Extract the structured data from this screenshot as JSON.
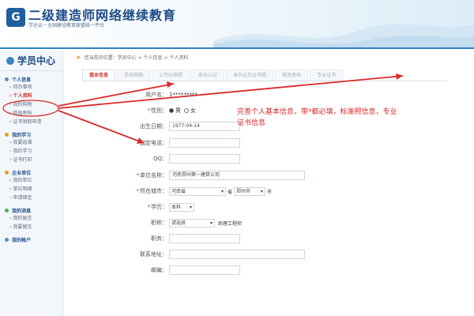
{
  "header": {
    "logo_char": "G",
    "brand": "二级建造师网络继续教育",
    "subtitle": "学达云－全国建设教育联盟统一平台"
  },
  "sidebar": {
    "title": "学员中心",
    "sections": [
      {
        "title": "个人信息",
        "items": [
          "待办事项",
          "个人资料",
          "我的购物",
          "修改密码",
          "证书领取申请"
        ]
      },
      {
        "title": "我的学习",
        "items": [
          "我要选课",
          "我的学习",
          "证书打印"
        ]
      },
      {
        "title": "企业单位",
        "items": [
          "我的单位",
          "单位明细",
          "申请绑定"
        ]
      },
      {
        "title": "我的消息",
        "items": [
          "我的留言",
          "我要留言"
        ]
      },
      {
        "title": "我的帐户",
        "items": []
      }
    ]
  },
  "breadcrumb": "您当前的位置：学员中心 > 个人信息 > 个人资料",
  "tabs": [
    "基本信息",
    "手机邮箱",
    "上传标准照",
    "身份认证",
    "身份证及证书照",
    "修改密码",
    "专业证书"
  ],
  "form": {
    "user_label": "用户名：",
    "user_value": "1*********",
    "gender_label": "性别：",
    "gender_male": "男",
    "gender_female": "女",
    "birth_label": "出生日期：",
    "birth_value": "1977-04-14",
    "phone_label": "固定电话：",
    "phone_value": "",
    "qq_label": "QQ：",
    "qq_value": "",
    "company_label": "单位名称：",
    "company_value": "河南郑州第一建筑公司",
    "city_label": "所在城市：",
    "province_value": "河南省",
    "province_suffix": "省",
    "city_value": "郑州市",
    "city_suffix": "市",
    "education_label": "学历：",
    "education_value": "本科",
    "title_label": "职称：",
    "title_value": "请选择",
    "title_extra": "助理工程师",
    "position_label": "职务：",
    "address_label": "联系地址：",
    "email_label": "邮编："
  },
  "annotation": {
    "text": "完善个人基本信息，带*都必填，标准照信息，专业证书信息"
  },
  "colors": {
    "accent": "#d92a2a",
    "brand_blue": "#1c4c86",
    "tab_active": "#c93a35"
  }
}
